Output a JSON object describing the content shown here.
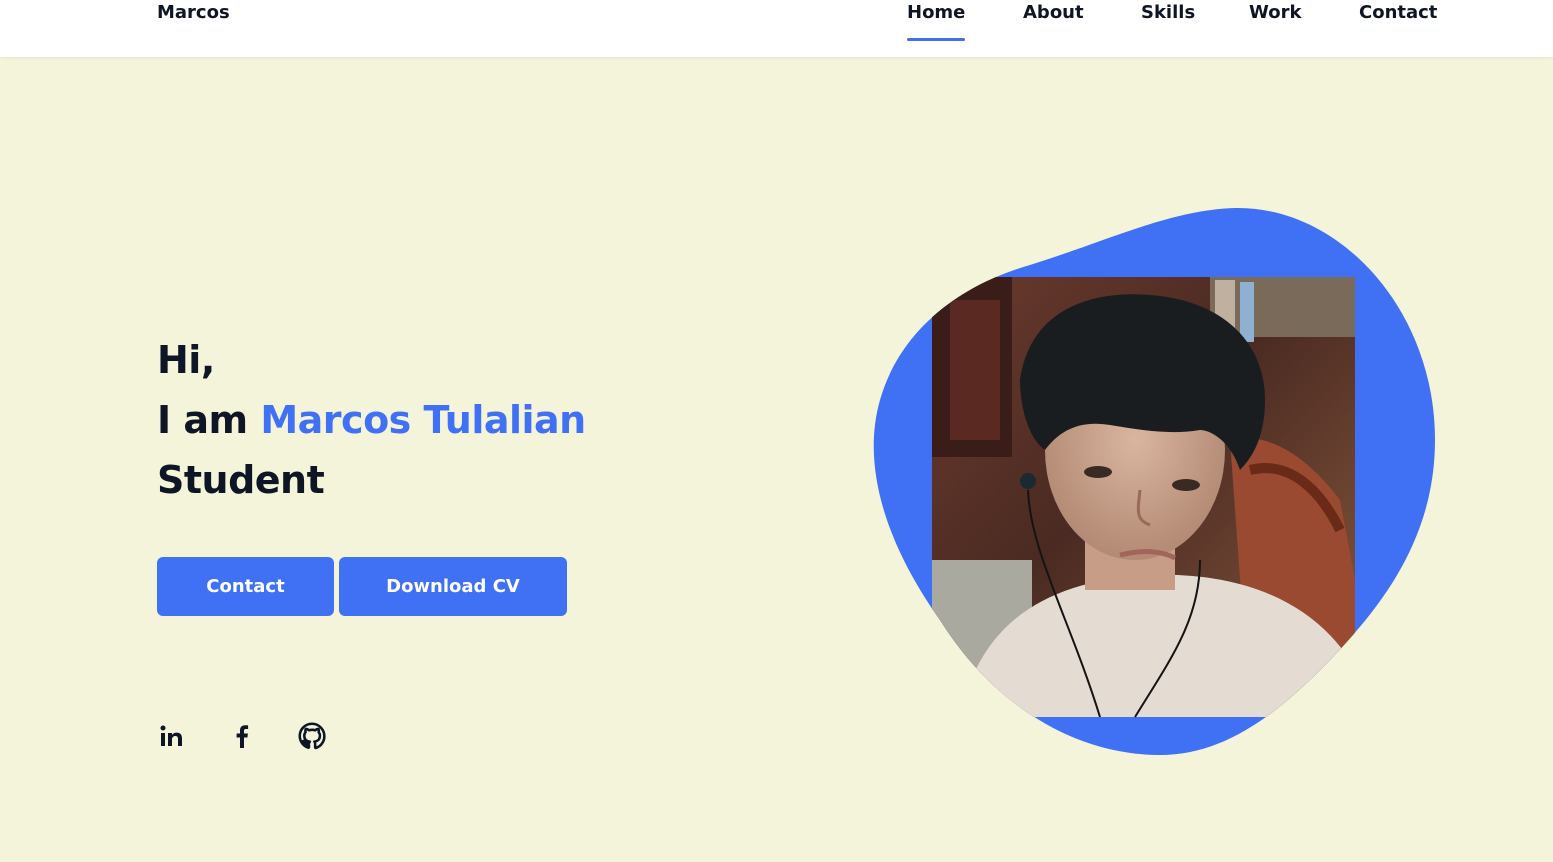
{
  "header": {
    "logo": "Marcos",
    "nav": [
      "Home",
      "About",
      "Skills",
      "Work",
      "Contact"
    ],
    "active_nav": "Home"
  },
  "hero": {
    "greeting": "Hi,",
    "intro_prefix": "I am",
    "name": "Marcos Tulalian",
    "role": "Student",
    "buttons": {
      "contact": "Contact",
      "download": "Download CV"
    }
  },
  "social": {
    "icons": [
      "linkedin-icon",
      "facebook-icon",
      "github-icon"
    ],
    "labels": [
      "in",
      "f",
      ""
    ]
  },
  "colors": {
    "accent": "#4070f4",
    "background": "#f4f4db",
    "text": "#0e1525",
    "header_bg": "#ffffff"
  }
}
